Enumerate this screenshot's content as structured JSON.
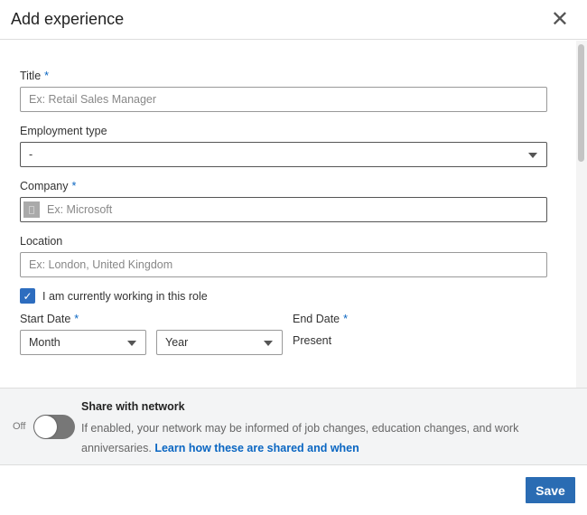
{
  "header": {
    "title": "Add experience",
    "close_icon": "close-icon"
  },
  "form": {
    "title": {
      "label": "Title",
      "required": "*",
      "placeholder": "Ex: Retail Sales Manager"
    },
    "employment_type": {
      "label": "Employment type",
      "value": "-"
    },
    "company": {
      "label": "Company",
      "required": "*",
      "placeholder": "Ex: Microsoft"
    },
    "location": {
      "label": "Location",
      "placeholder": "Ex: London, United Kingdom"
    },
    "current_role": {
      "label": "I am currently working in this role",
      "checked": true
    },
    "start_date": {
      "label": "Start Date",
      "required": "*",
      "month": "Month",
      "year": "Year"
    },
    "end_date": {
      "label": "End Date",
      "required": "*",
      "value": "Present"
    }
  },
  "share": {
    "title": "Share with network",
    "state": "Off",
    "description": "If enabled, your network may be informed of job changes, education changes, and work anniversaries.",
    "link": "Learn how these are shared and when"
  },
  "footer": {
    "save_label": "Save"
  },
  "colors": {
    "accent": "#0a66c2",
    "button": "#2a6cb3"
  }
}
